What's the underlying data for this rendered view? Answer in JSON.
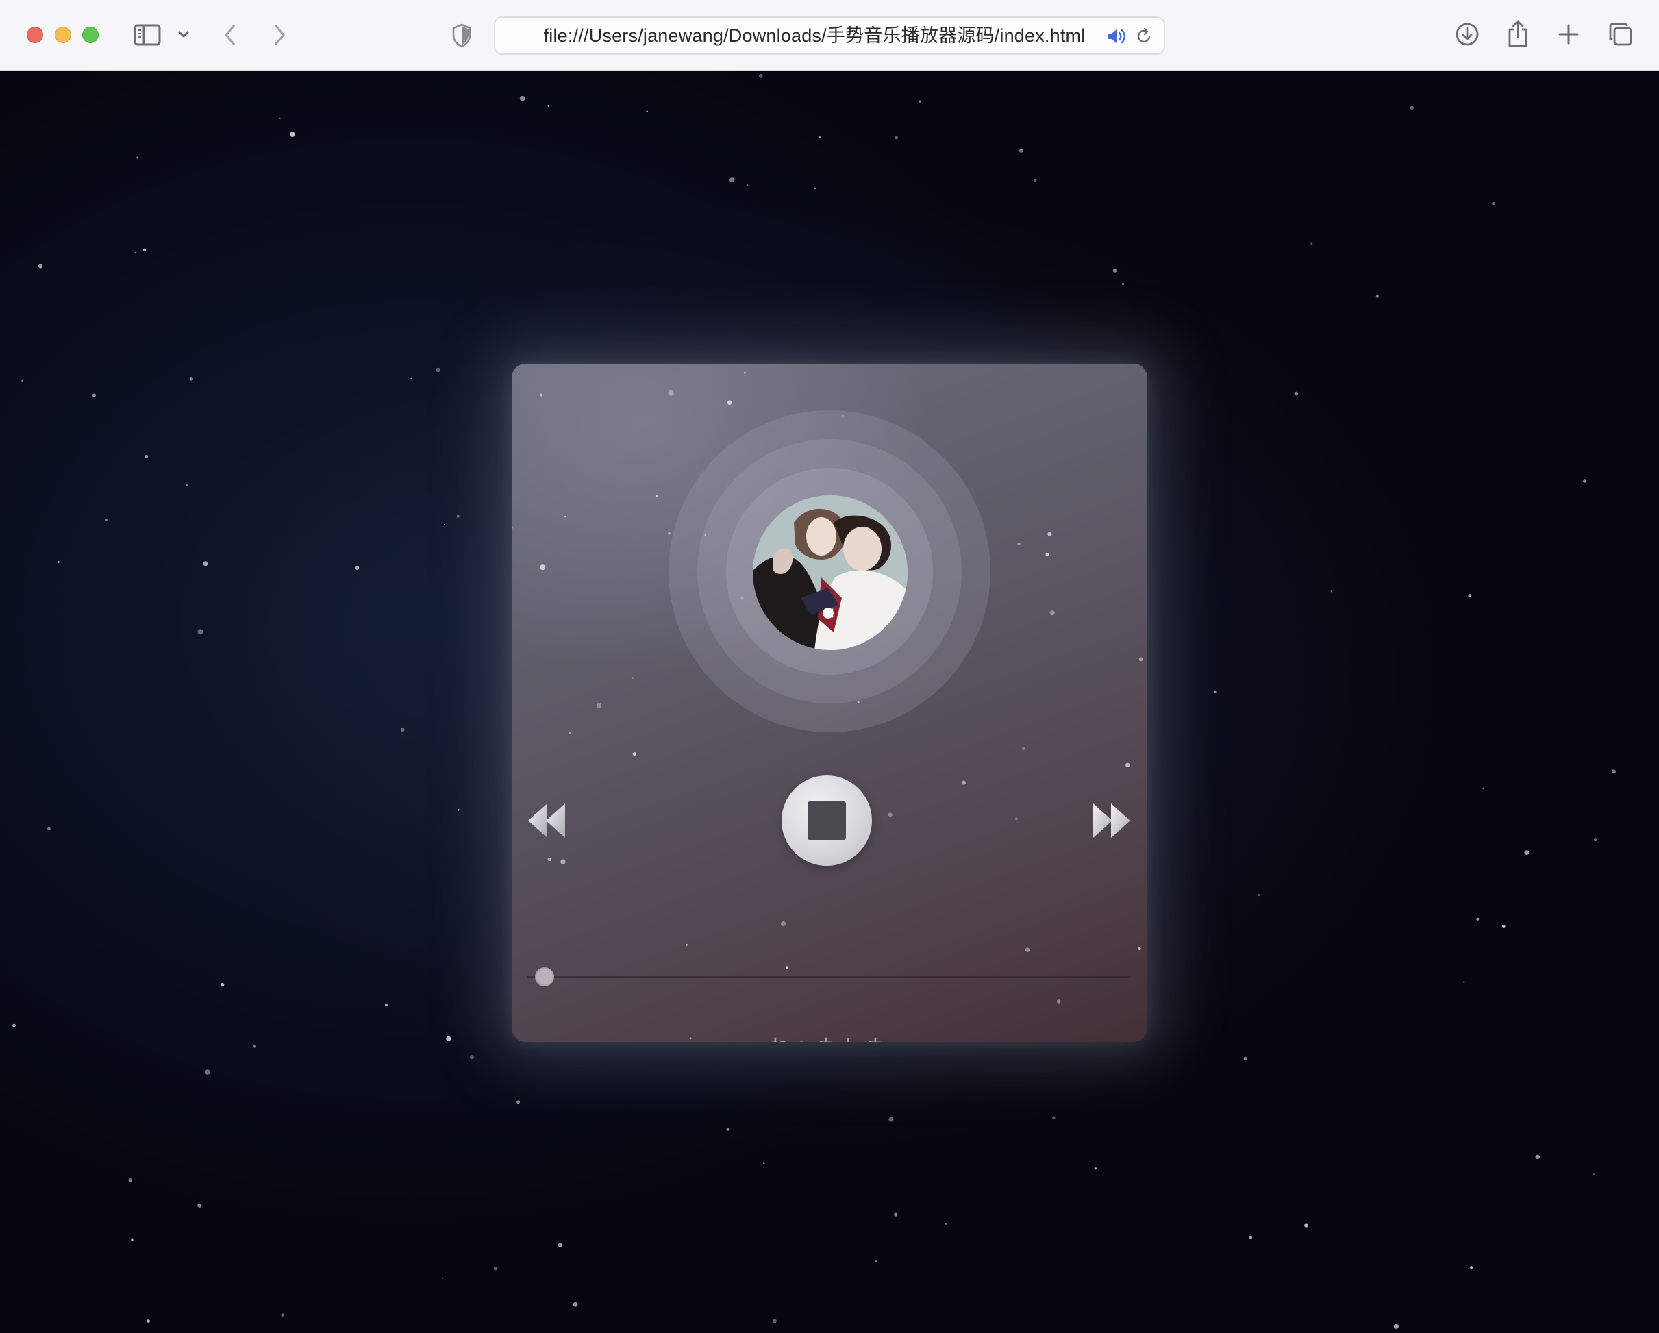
{
  "browser": {
    "url": "file:///Users/janewang/Downloads/手势音乐播放器源码/index.html",
    "icons": {
      "sidebar": "sidebar-icon",
      "sidebar_menu": "chevron-down-icon",
      "back": "chevron-left-icon",
      "forward": "chevron-right-icon",
      "privacy": "shield-icon",
      "audio": "speaker-icon",
      "reload": "reload-icon",
      "downloads": "download-icon",
      "share": "share-icon",
      "new_tab": "plus-icon",
      "tab_overview": "tabs-icon"
    }
  },
  "player": {
    "song_title": "ねぇもしも",
    "progress": 0.02,
    "state": "playing",
    "controls": [
      "previous",
      "stop",
      "next"
    ],
    "accent": "#d6d5da"
  }
}
